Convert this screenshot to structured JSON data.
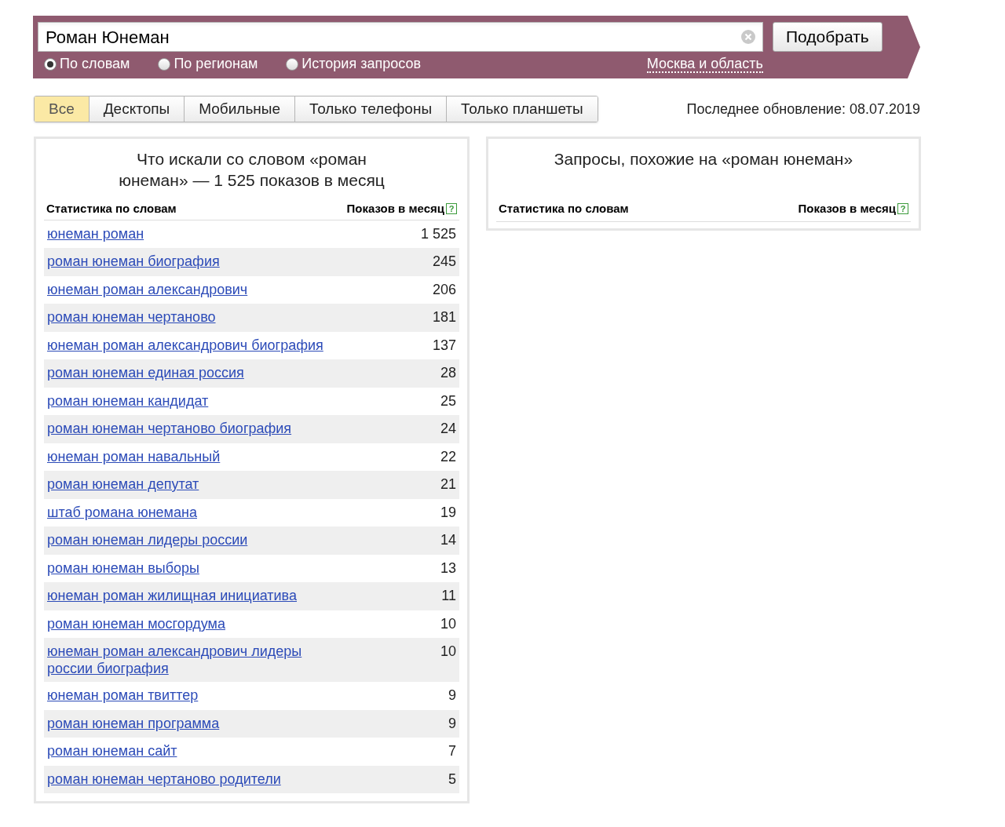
{
  "search": {
    "value": "Роман Юнеман",
    "button": "Подобрать"
  },
  "modes": [
    {
      "label": "По словам",
      "selected": true
    },
    {
      "label": "По регионам",
      "selected": false
    },
    {
      "label": "История запросов",
      "selected": false
    }
  ],
  "region": "Москва и область",
  "tabs": [
    {
      "label": "Все",
      "selected": true
    },
    {
      "label": "Десктопы",
      "selected": false
    },
    {
      "label": "Мобильные",
      "selected": false
    },
    {
      "label": "Только телефоны",
      "selected": false
    },
    {
      "label": "Только планшеты",
      "selected": false
    }
  ],
  "last_update": "Последнее обновление: 08.07.2019",
  "left_panel": {
    "title": "Что искали со словом «роман юнеман» — 1 525 показов в месяц",
    "columns": [
      "Статистика по словам",
      "Показов в месяц"
    ],
    "help": "?",
    "rows": [
      {
        "phrase": "юнеман роман",
        "count": "1 525"
      },
      {
        "phrase": "роман юнеман биография",
        "count": "245"
      },
      {
        "phrase": "юнеман роман александрович",
        "count": "206"
      },
      {
        "phrase": "роман юнеман чертаново",
        "count": "181"
      },
      {
        "phrase": "юнеман роман александрович биография",
        "count": "137"
      },
      {
        "phrase": "роман юнеман единая россия",
        "count": "28"
      },
      {
        "phrase": "роман юнеман кандидат",
        "count": "25"
      },
      {
        "phrase": "роман юнеман чертаново биография",
        "count": "24"
      },
      {
        "phrase": "юнеман роман навальный",
        "count": "22"
      },
      {
        "phrase": "роман юнеман депутат",
        "count": "21"
      },
      {
        "phrase": "штаб романа юнемана",
        "count": "19"
      },
      {
        "phrase": "роман юнеман лидеры россии",
        "count": "14"
      },
      {
        "phrase": "роман юнеман выборы",
        "count": "13"
      },
      {
        "phrase": "юнеман роман жилищная инициатива",
        "count": "11"
      },
      {
        "phrase": "роман юнеман мосгордума",
        "count": "10"
      },
      {
        "phrase": "юнеман роман александрович лидеры россии биография",
        "count": "10"
      },
      {
        "phrase": "юнеман роман твиттер",
        "count": "9"
      },
      {
        "phrase": "роман юнеман программа",
        "count": "9"
      },
      {
        "phrase": "роман юнеман сайт",
        "count": "7"
      },
      {
        "phrase": "роман юнеман чертаново родители",
        "count": "5"
      }
    ]
  },
  "right_panel": {
    "title": "Запросы, похожие на «роман юнеман»",
    "columns": [
      "Статистика по словам",
      "Показов в месяц"
    ],
    "help": "?"
  }
}
